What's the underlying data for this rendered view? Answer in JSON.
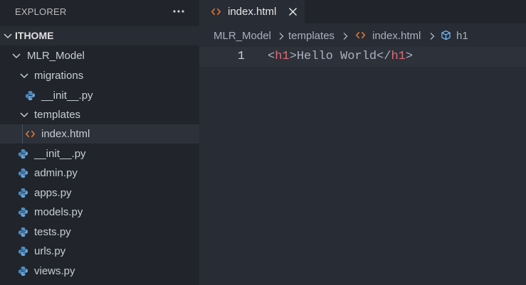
{
  "sidebar": {
    "title": "EXPLORER",
    "more_icon": "ellipsis-icon",
    "section": "ITHOME",
    "tree": [
      {
        "label": "MLR_Model",
        "kind": "folder",
        "expanded": true
      },
      {
        "label": "migrations",
        "kind": "folder",
        "expanded": true
      },
      {
        "label": "__init__.py",
        "kind": "python"
      },
      {
        "label": "templates",
        "kind": "folder",
        "expanded": true
      },
      {
        "label": "index.html",
        "kind": "html",
        "selected": true
      },
      {
        "label": "__init__.py",
        "kind": "python"
      },
      {
        "label": "admin.py",
        "kind": "python"
      },
      {
        "label": "apps.py",
        "kind": "python"
      },
      {
        "label": "models.py",
        "kind": "python"
      },
      {
        "label": "tests.py",
        "kind": "python"
      },
      {
        "label": "urls.py",
        "kind": "python"
      },
      {
        "label": "views.py",
        "kind": "python"
      }
    ]
  },
  "tab": {
    "label": "index.html",
    "icon": "html-file-icon",
    "close_icon": "close-icon"
  },
  "breadcrumb": [
    "MLR_Model",
    "templates",
    "index.html",
    "h1"
  ],
  "editor": {
    "line_number": "1",
    "tokens": {
      "open_bracket": "<",
      "open_tag": "h1",
      "open_close_bracket": ">",
      "text": "Hello World",
      "close_open_bracket": "</",
      "close_tag": "h1",
      "close_close_bracket": ">"
    }
  },
  "colors": {
    "sidebar_bg": "#21252b",
    "editor_bg": "#282c34",
    "html_icon": "#e37933",
    "python_icon": "#4a8ec7",
    "tag": "#e06c75",
    "symbol_icon": "#75beff"
  }
}
